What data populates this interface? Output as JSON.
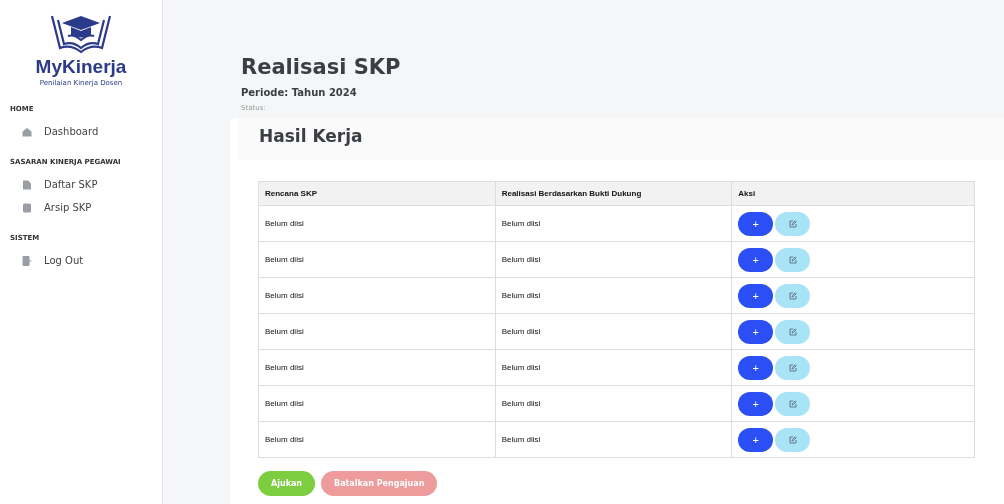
{
  "brand": {
    "name": "MyKinerja",
    "tagline": "Penilaian Kinerja Dosen"
  },
  "sidebar": {
    "sections": [
      {
        "heading": "HOME",
        "items": [
          {
            "label": "Dashboard",
            "kind": "home"
          }
        ]
      },
      {
        "heading": "SASARAN KINERJA PEGAWAI",
        "items": [
          {
            "label": "Daftar SKP",
            "kind": "file"
          },
          {
            "label": "Arsip SKP",
            "kind": "archive"
          }
        ]
      },
      {
        "heading": "SISTEM",
        "items": [
          {
            "label": "Log Out",
            "kind": "logout"
          }
        ]
      }
    ]
  },
  "page": {
    "title": "Realisasi SKP",
    "period": "Periode: Tahun 2024",
    "status": "Status:"
  },
  "card": {
    "title": "Hasil Kerja"
  },
  "table": {
    "columns": [
      "Rencana SKP",
      "Realisasi Berdasarkan Bukti Dukung",
      "Aksi"
    ],
    "rows": [
      {
        "plan": "Belum diisi",
        "realization": "Belum diisi",
        "add_label": "+"
      },
      {
        "plan": "Belum diisi",
        "realization": "Belum diisi",
        "add_label": "+"
      },
      {
        "plan": "Belum diisi",
        "realization": "Belum diisi",
        "add_label": "+"
      },
      {
        "plan": "Belum diisi",
        "realization": "Belum diisi",
        "add_label": "+"
      },
      {
        "plan": "Belum diisi",
        "realization": "Belum diisi",
        "add_label": "+"
      },
      {
        "plan": "Belum diisi",
        "realization": "Belum diisi",
        "add_label": "+"
      },
      {
        "plan": "Belum diisi",
        "realization": "Belum diisi",
        "add_label": "+"
      }
    ]
  },
  "actions": [
    {
      "label": "Ajukan",
      "kind": "submit",
      "disabled": false
    },
    {
      "label": "Batalkan Pengajuan",
      "kind": "cancel",
      "disabled": true
    }
  ]
}
